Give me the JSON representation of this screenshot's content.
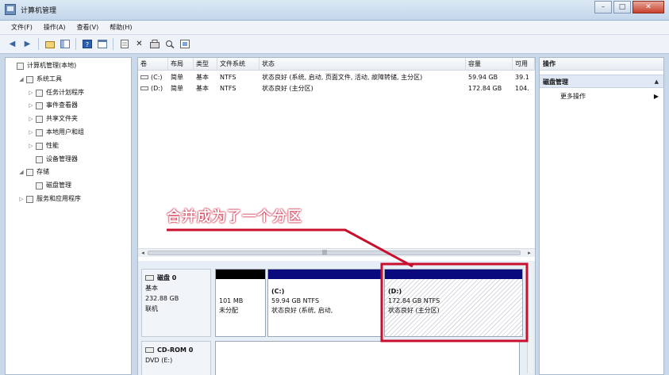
{
  "window": {
    "title": "计算机管理",
    "controls": [
      "–",
      "□",
      "✕"
    ]
  },
  "menu": [
    "文件(F)",
    "操作(A)",
    "查看(V)",
    "帮助(H)"
  ],
  "toolbar_icons": [
    "back-icon",
    "forward-icon",
    "up-folder-icon",
    "show-hide-tree-icon",
    "help-icon",
    "console-icon",
    "settings-icon",
    "delete-icon",
    "properties-icon",
    "search-icon",
    "export-icon"
  ],
  "tree": {
    "items": [
      {
        "label": "计算机管理(本地)",
        "level": 0,
        "arrow": ""
      },
      {
        "label": "系统工具",
        "level": 1,
        "arrow": "◢"
      },
      {
        "label": "任务计划程序",
        "level": 2,
        "arrow": "▷"
      },
      {
        "label": "事件查看器",
        "level": 2,
        "arrow": "▷"
      },
      {
        "label": "共享文件夹",
        "level": 2,
        "arrow": "▷"
      },
      {
        "label": "本地用户和组",
        "level": 2,
        "arrow": "▷"
      },
      {
        "label": "性能",
        "level": 2,
        "arrow": "▷"
      },
      {
        "label": "设备管理器",
        "level": 2,
        "arrow": ""
      },
      {
        "label": "存储",
        "level": 1,
        "arrow": "◢"
      },
      {
        "label": "磁盘管理",
        "level": 2,
        "arrow": ""
      },
      {
        "label": "服务和应用程序",
        "level": 1,
        "arrow": "▷"
      }
    ]
  },
  "volumes": {
    "headers": [
      "卷",
      "布局",
      "类型",
      "文件系统",
      "状态",
      "容量",
      "可用"
    ],
    "rows": [
      [
        "(C:)",
        "简单",
        "基本",
        "NTFS",
        "状态良好 (系统, 启动, 页面文件, 活动, 故障转储, 主分区)",
        "59.94 GB",
        "39.1"
      ],
      [
        "(D:)",
        "简单",
        "基本",
        "NTFS",
        "状态良好 (主分区)",
        "172.84 GB",
        "104."
      ]
    ]
  },
  "hscroll": {
    "mid": "|||"
  },
  "disks": [
    {
      "name": "磁盘 0",
      "type": "基本",
      "size": "232.88 GB",
      "status": "联机",
      "partitions": [
        {
          "line1": "",
          "line2": "101 MB",
          "line3": "未分配",
          "color": "#000000"
        },
        {
          "line1": "(C:)",
          "line2": "59.94 GB NTFS",
          "line3": "状态良好 (系统, 启动,",
          "color": "#0a0a7e"
        },
        {
          "line1": "(D:)",
          "line2": "172.84 GB NTFS",
          "line3": "状态良好 (主分区)",
          "color": "#0a0a7e"
        }
      ]
    },
    {
      "name": "CD-ROM 0",
      "type": "DVD (E:)",
      "size": "",
      "status": "",
      "partitions": []
    }
  ],
  "actions": {
    "header": "操作",
    "section": "磁盘管理",
    "section_arrow": "▲",
    "item": "更多操作",
    "item_arrow": "▶"
  },
  "annotation": {
    "text": "合并成为了一个分区",
    "color": "#c8102e"
  }
}
